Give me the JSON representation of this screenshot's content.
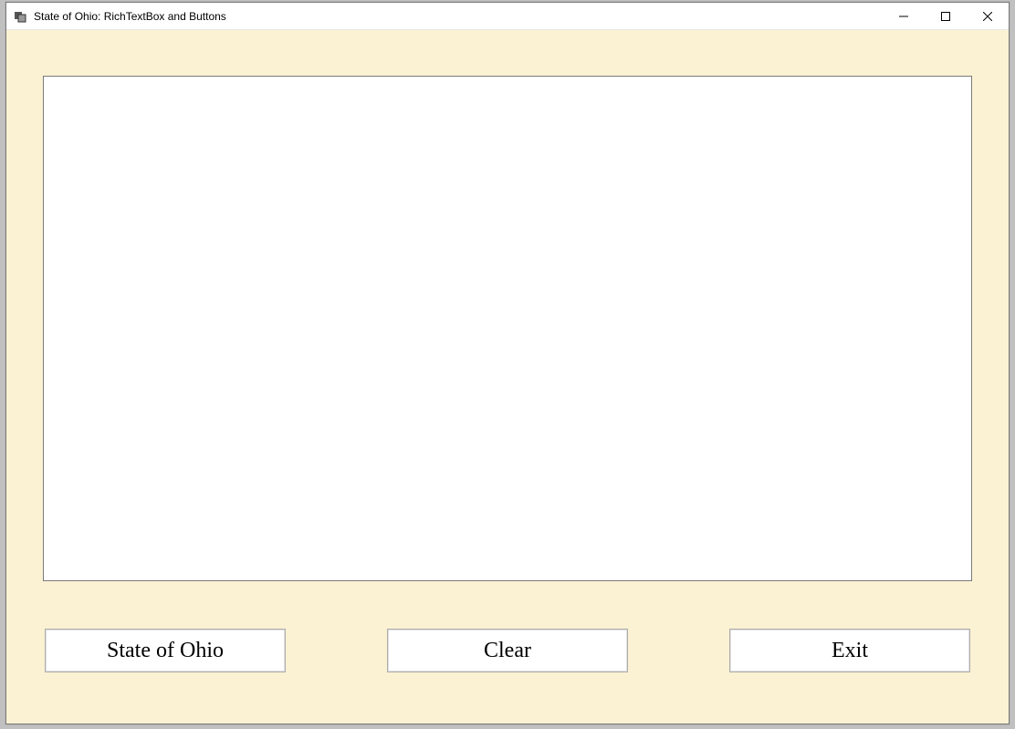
{
  "window": {
    "title": "State of Ohio: RichTextBox and Buttons"
  },
  "richtextbox": {
    "value": ""
  },
  "buttons": {
    "state_of_ohio": "State of Ohio",
    "clear": "Clear",
    "exit": "Exit"
  }
}
